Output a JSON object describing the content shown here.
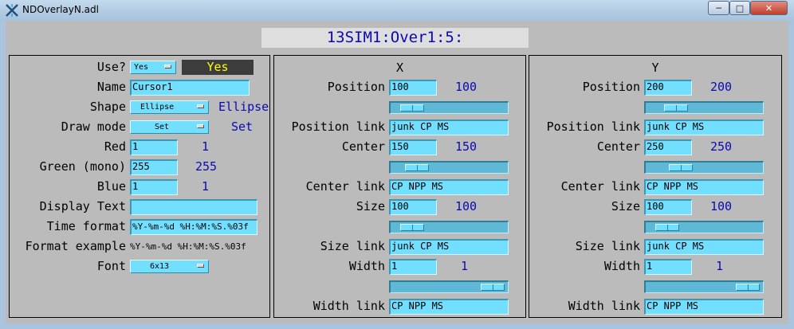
{
  "window": {
    "title": "NDOverlayN.adl"
  },
  "header": {
    "pv_title": "13SIM1:Over1:5:"
  },
  "left": {
    "use": {
      "label": "Use?",
      "menu": "Yes",
      "readback": "Yes"
    },
    "name": {
      "label": "Name",
      "value": "Cursor1"
    },
    "shape": {
      "label": "Shape",
      "menu": "Ellipse",
      "readback": "Ellipse"
    },
    "draw_mode": {
      "label": "Draw mode",
      "menu": "Set",
      "readback": "Set"
    },
    "red": {
      "label": "Red",
      "value": "1",
      "readback": "1"
    },
    "green": {
      "label": "Green (mono)",
      "value": "255",
      "readback": "255"
    },
    "blue": {
      "label": "Blue",
      "value": "1",
      "readback": "1"
    },
    "display_text": {
      "label": "Display Text",
      "value": ""
    },
    "time_format": {
      "label": "Time format",
      "value": "%Y-%m-%d %H:%M:%S.%03f"
    },
    "format_example": {
      "label": "Format example",
      "value": "%Y-%m-%d %H:%M:%S.%03f"
    },
    "font": {
      "label": "Font",
      "menu": "6x13"
    }
  },
  "x_panel": {
    "title": "X",
    "position": {
      "label": "Position",
      "value": "100",
      "readback": "100",
      "slider_fraction": 0.1
    },
    "position_link": {
      "label": "Position link",
      "value": "junk CP MS"
    },
    "center": {
      "label": "Center",
      "value": "150",
      "readback": "150",
      "slider_fraction": 0.15
    },
    "center_link": {
      "label": "Center link",
      "value": "CP NPP MS"
    },
    "size": {
      "label": "Size",
      "value": "100",
      "readback": "100",
      "slider_fraction": 0.1
    },
    "size_link": {
      "label": "Size link",
      "value": "junk CP MS"
    },
    "width": {
      "label": "Width",
      "value": "1",
      "readback": "1",
      "slider_fraction": 0.97
    },
    "width_link": {
      "label": "Width link",
      "value": "CP NPP MS"
    }
  },
  "y_panel": {
    "title": "Y",
    "position": {
      "label": "Position",
      "value": "200",
      "readback": "200",
      "slider_fraction": 0.2
    },
    "position_link": {
      "label": "Position link",
      "value": "junk CP MS"
    },
    "center": {
      "label": "Center",
      "value": "250",
      "readback": "250",
      "slider_fraction": 0.25
    },
    "center_link": {
      "label": "Center link",
      "value": "CP NPP MS"
    },
    "size": {
      "label": "Size",
      "value": "100",
      "readback": "100",
      "slider_fraction": 0.1
    },
    "size_link": {
      "label": "Size link",
      "value": "junk CP MS"
    },
    "width": {
      "label": "Width",
      "value": "1",
      "readback": "1",
      "slider_fraction": 0.97
    },
    "width_link": {
      "label": "Width link",
      "value": "CP NPP MS"
    }
  },
  "colors": {
    "field_bg": "#73dfff",
    "readback_text": "#0a0ab4",
    "panel_bg": "#bbbbbb",
    "use_readback_text": "#ffff00",
    "use_readback_bg": "#3c3c3c"
  }
}
